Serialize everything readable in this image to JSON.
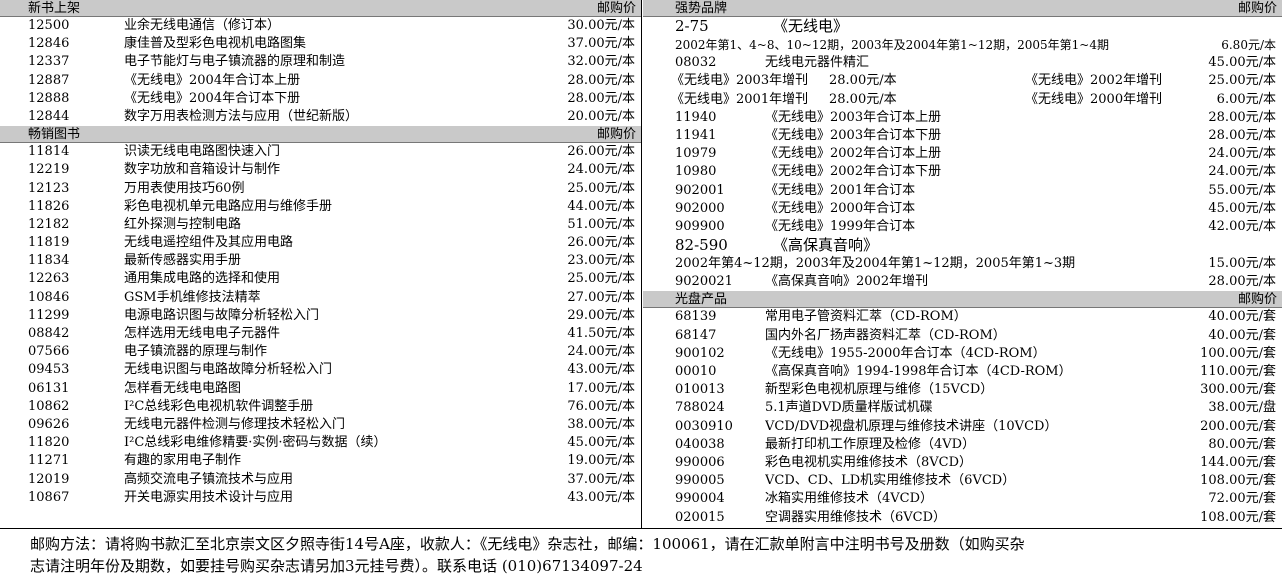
{
  "new_books": {
    "header": "新书上架",
    "price_header": "邮购价",
    "items": [
      {
        "code": "12500",
        "title": "业余无线电通信（修订本）",
        "price": "30.00元/本"
      },
      {
        "code": "12846",
        "title": "康佳普及型彩色电视机电路图集",
        "price": "37.00元/本"
      },
      {
        "code": "12337",
        "title": "电子节能灯与电子镇流器的原理和制造",
        "price": "32.00元/本"
      },
      {
        "code": "12887",
        "title": "《无线电》2004年合订本上册",
        "price": "28.00元/本"
      },
      {
        "code": "12888",
        "title": "《无线电》2004年合订本下册",
        "price": "28.00元/本"
      },
      {
        "code": "12844",
        "title": "数字万用表检测方法与应用（世纪新版）",
        "price": "20.00元/本"
      }
    ]
  },
  "bestsellers": {
    "header": "畅销图书",
    "price_header": "邮购价",
    "items": [
      {
        "code": "11814",
        "title": "识读无线电电路图快速入门",
        "price": "26.00元/本"
      },
      {
        "code": "12219",
        "title": "数字功放和音箱设计与制作",
        "price": "24.00元/本"
      },
      {
        "code": "12123",
        "title": "万用表使用技巧60例",
        "price": "25.00元/本"
      },
      {
        "code": "11826",
        "title": "彩色电视机单元电路应用与维修手册",
        "price": "44.00元/本"
      },
      {
        "code": "12182",
        "title": "红外探测与控制电路",
        "price": "51.00元/本"
      },
      {
        "code": "11819",
        "title": "无线电遥控组件及其应用电路",
        "price": "26.00元/本"
      },
      {
        "code": "11834",
        "title": "最新传感器实用手册",
        "price": "23.00元/本"
      },
      {
        "code": "12263",
        "title": "通用集成电路的选择和使用",
        "price": "25.00元/本"
      },
      {
        "code": "10846",
        "title": "GSM手机维修技法精萃",
        "price": "27.00元/本"
      },
      {
        "code": "11299",
        "title": "电源电路识图与故障分析轻松入门",
        "price": "29.00元/本"
      },
      {
        "code": "08842",
        "title": "怎样选用无线电电子元器件",
        "price": "41.50元/本"
      },
      {
        "code": "07566",
        "title": "电子镇流器的原理与制作",
        "price": "24.00元/本"
      },
      {
        "code": "09453",
        "title": "无线电识图与电路故障分析轻松入门",
        "price": "43.00元/本"
      },
      {
        "code": "06131",
        "title": "怎样看无线电电路图",
        "price": "17.00元/本"
      },
      {
        "code": "10862",
        "title": "I²C总线彩色电视机软件调整手册",
        "price": "76.00元/本"
      },
      {
        "code": "09626",
        "title": "无线电元器件检测与修理技术轻松入门",
        "price": "38.00元/本"
      },
      {
        "code": "11820",
        "title": "I²C总线彩电维修精要·实例·密码与数据（续）",
        "price": "45.00元/本"
      },
      {
        "code": "11271",
        "title": "有趣的家用电子制作",
        "price": "19.00元/本"
      },
      {
        "code": "12019",
        "title": "高频交流电子镇流技术与应用",
        "price": "37.00元/本"
      },
      {
        "code": "10867",
        "title": "开关电源实用技术设计与应用",
        "price": "43.00元/本"
      }
    ]
  },
  "brands": {
    "header": "强势品牌",
    "price_header": "邮购价",
    "wireless_code": "2-75",
    "wireless_name": "《无线电》",
    "wireless_issues": "2002年第1、4~8、10~12期，2003年及2004年第1~12期，2005年第1~4期",
    "wireless_issues_price": "6.80元/本",
    "row_08032": {
      "code": "08032",
      "title": "无线电元器件精汇",
      "price": "45.00元/本"
    },
    "annual_pairs": [
      {
        "t1": "《无线电》2003年增刊",
        "p1": "28.00元/本",
        "t2": "《无线电》2002年增刊",
        "p2": "25.00元/本"
      },
      {
        "t1": "《无线电》2001年增刊",
        "p1": "28.00元/本",
        "t2": "《无线电》2000年增刊",
        "p2": "6.00元/本"
      }
    ],
    "items": [
      {
        "code": "11940",
        "title": "《无线电》2003年合订本上册",
        "price": "28.00元/本"
      },
      {
        "code": "11941",
        "title": "《无线电》2003年合订本下册",
        "price": "28.00元/本"
      },
      {
        "code": "10979",
        "title": "《无线电》2002年合订本上册",
        "price": "24.00元/本"
      },
      {
        "code": "10980",
        "title": "《无线电》2002年合订本下册",
        "price": "24.00元/本"
      },
      {
        "code": "902001",
        "title": "《无线电》2001年合订本",
        "price": "55.00元/本"
      },
      {
        "code": "902000",
        "title": "《无线电》2000年合订本",
        "price": "45.00元/本"
      },
      {
        "code": "909900",
        "title": "《无线电》1999年合订本",
        "price": "42.00元/本"
      }
    ],
    "hifi_code": "82-590",
    "hifi_name": "《高保真音响》",
    "hifi_issues": "2002年第4~12期，2003年及2004年第1~12期，2005年第1~3期",
    "hifi_issues_price": "15.00元/本",
    "row_hifi": {
      "code": "9020021",
      "title": "《高保真音响》2002年增刊",
      "price": "28.00元/本"
    }
  },
  "discs": {
    "header": "光盘产品",
    "price_header": "邮购价",
    "items": [
      {
        "code": "68139",
        "title": "常用电子管资料汇萃（CD-ROM）",
        "price": "40.00元/套"
      },
      {
        "code": "68147",
        "title": "国内外名厂扬声器资料汇萃（CD-ROM）",
        "price": "40.00元/套"
      },
      {
        "code": "900102",
        "title": "《无线电》1955-2000年合订本（4CD-ROM）",
        "price": "100.00元/套"
      },
      {
        "code": "00010",
        "title": "《高保真音响》1994-1998年合订本（4CD-ROM）",
        "price": "110.00元/套"
      },
      {
        "code": "010013",
        "title": "新型彩色电视机原理与维修（15VCD）",
        "price": "300.00元/套"
      },
      {
        "code": "788024",
        "title": "5.1声道DVD质量样版试机碟",
        "price": "38.00元/盘"
      },
      {
        "code": "0030910",
        "title": "VCD/DVD视盘机原理与维修技术讲座（10VCD）",
        "price": "200.00元/套"
      },
      {
        "code": "040038",
        "title": "最新打印机工作原理及检修（4VD）",
        "price": "80.00元/套"
      },
      {
        "code": "990006",
        "title": "彩色电视机实用维修技术（8VCD）",
        "price": "144.00元/套"
      },
      {
        "code": "990005",
        "title": "VCD、CD、LD机实用维修技术（6VCD）",
        "price": "108.00元/套"
      },
      {
        "code": "990004",
        "title": "冰箱实用维修技术（4VCD）",
        "price": "72.00元/套"
      },
      {
        "code": "020015",
        "title": "空调器实用维修技术（6VCD）",
        "price": "108.00元/套"
      }
    ]
  },
  "footer": {
    "line1": "邮购方法：请将购书款汇至北京崇文区夕照寺街14号A座，收款人：《无线电》杂志社，邮编：100061，请在汇款单附言中注明书号及册数（如购买杂",
    "line2": "志请注明年份及期数，如要挂号购买杂志请另加3元挂号费）。联系电话 (010)67134097-24"
  }
}
